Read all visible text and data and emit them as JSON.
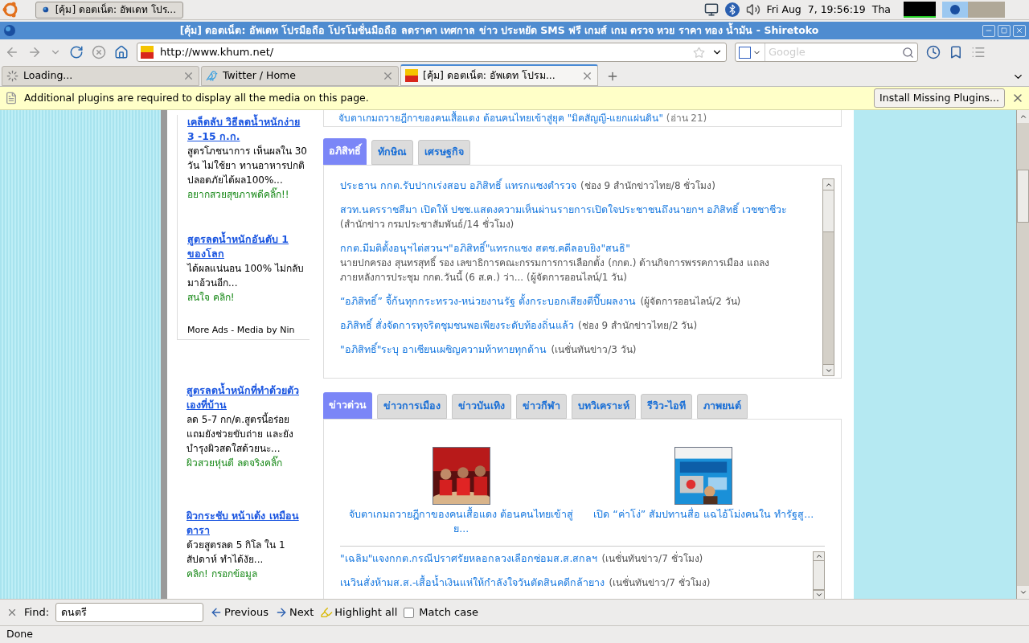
{
  "panel": {
    "taskbar_button": "[คุ้ม] ดอตเน็ต: อัพเดท โปร...",
    "clock": "Fri Aug  7, 19:56:19",
    "keyboard_layout": "Tha"
  },
  "window": {
    "title": "[คุ้ม] ดอตเน็ต: อัพเดท โปรมือถือ โปรโมชั่นมือถือ ลดราคา เทศกาล ข่าว ประหยัด SMS ฟรี เกมส์ เกม ตรวจ หวย ราคา ทอง น้ำมัน - Shiretoko"
  },
  "toolbar": {
    "url": "http://www.khum.net/",
    "search_placeholder": "Google"
  },
  "tabs": [
    {
      "kind": "loading",
      "label": "Loading...",
      "selected": false
    },
    {
      "kind": "bird",
      "label": "Twitter / Home",
      "selected": false
    },
    {
      "kind": "site",
      "label": "[คุ้ม] ดอตเน็ต: อัพเดท โปรม...",
      "selected": true
    }
  ],
  "notification": {
    "message": "Additional plugins are required to display all the media on this page.",
    "button": "Install Missing Plugins..."
  },
  "page": {
    "headline": {
      "title": "จับตาเกมถวายฎีกาของคนเสื้อแดง ต้อนคนไทยเข้าสู่ยุค \"มิคสัญญี-แยกแผ่นดิน\"",
      "meta": "(อ่าน 21)"
    },
    "ad_box": {
      "ads": [
        {
          "title": "เคล็ดลับ วิธีลดน้ำหนักง่าย 3 -15 ก.ก.",
          "body": "สูตรโภชนาการ เห็นผลใน 30 วัน ไม่ใช้ยา ทานอาหารปกติ ปลอดภัยได้ผล100%...",
          "action": "อยากสวยสุขภาพดีคลิ๊ก!!"
        },
        {
          "title": "สูตรลดน้ำหนักอันดับ 1 ของโลก",
          "body": "ได้ผลแน่นอน 100% ไม่กลับมาอ้วนอีก...",
          "action": "สนใจ คลิก!"
        }
      ],
      "footer": "More Ads - Media by Nin"
    },
    "more_ads": [
      {
        "title": "สูตรลดน้ำหนักที่ทำด้วยตัวเองที่บ้าน",
        "body": "ลด 5-7 กก/ด.สูตรนี้อร่อย แถมยังช่วยขับถ่าย และยังบำรุงผิวสดใสด้วยนะ...",
        "action": "ผิวสวยหุ่นดี ลดจริงคลิ๊ก"
      },
      {
        "title": "ผิวกระชับ หน้าเด้ง เหมือนดารา",
        "body": "ด้วยสูตรลด 5 กิโล ใน 1 สัปดาห์ ทำได้งัย...",
        "action": "คลิก! กรอกข้อมูล"
      }
    ],
    "tabs1": [
      {
        "label": "อภิสิทธิ์",
        "selected": true
      },
      {
        "label": "ทักษิณ",
        "selected": false
      },
      {
        "label": "เศรษฐกิจ",
        "selected": false
      }
    ],
    "news1": [
      {
        "title": "ประธาน กกต.รับปากเร่งสอบ อภิสิทธิ์ แทรกแซงตำรวจ",
        "meta": "(ช่อง 9 สำนักข่าวไทย/8 ชั่วโมง)"
      },
      {
        "title": "สวท.นครราชสีมา เปิดให้ ปชช.แสดงความเห็นผ่านรายการเปิดใจประชาชนถึงนายกฯ อภิสิทธิ์ เวชชาชีวะ",
        "meta": "(สำนักข่าว กรมประชาสัมพันธ์/14 ชั่วโมง)"
      },
      {
        "title": "กกต.มีมติตั้งอนุฯไต่สวนฯ\"อภิสิทธิ์\"แทรกแซง สตช.คดีลอบยิง\"สนธิ\"",
        "meta": "นายปกครอง สุนทรสุทธิ์ รอง เลขาธิการคณะกรรมการการเลือกตั้ง (กกต.) ด้านกิจการพรรคการเมือง แถลงภายหลังการประชุม กกต.วันนี้ (6 ส.ค.) ว่า... (ผู้จัดการออนไลน์/1 วัน)"
      },
      {
        "title": "“อภิสิทธิ์” จี้ก้นทุกกระทรวง-หน่วยงานรัฐ ตั้งกระบอกเสียงตีปี๊บผลงาน",
        "meta": "(ผู้จัดการออนไลน์/2 วัน)"
      },
      {
        "title": "อภิสิทธิ์ สั่งจัดการทุจริตชุมชนพอเพียงระดับท้องถิ่นแล้ว",
        "meta": "(ช่อง 9 สำนักข่าวไทย/2 วัน)"
      },
      {
        "title": "\"อภิสิทธิ์\"ระบุ อาเซียนเผชิญความท้าทายทุกด้าน",
        "meta": "(เนชั่นทันข่าว/3 วัน)"
      }
    ],
    "tabs2": [
      {
        "label": "ข่าวด่วน",
        "selected": true
      },
      {
        "label": "ข่าวการเมือง",
        "selected": false
      },
      {
        "label": "ข่าวบันเทิง",
        "selected": false
      },
      {
        "label": "ข่าวกีฬา",
        "selected": false
      },
      {
        "label": "บทวิเคราะห์",
        "selected": false
      },
      {
        "label": "รีวิว-ไอที",
        "selected": false
      },
      {
        "label": "ภาพยนต์",
        "selected": false
      }
    ],
    "featured": [
      {
        "kind": "picture",
        "caption": "จับตาเกมถวายฎีกาของคนเสื้อแดง ต้อนคนไทยเข้าสู่ย..."
      },
      {
        "kind": "picture",
        "caption": "เปิด “ค่าโง่” สัมปทานสื่อ แฉไอ้โม่งคนใน ทำรัฐสู..."
      }
    ],
    "news2": [
      {
        "title": "\"เฉลิม\"แจงกกต.กรณีปราศรัยหลอกลวงเลือกซ่อมส.ส.สกลฯ",
        "meta": "(เนชั่นทันข่าว/7 ชั่วโมง)"
      },
      {
        "title": "เนวินสั่งห้ามส.ส.-เสื้อน้ำเงินแห่ให้กำลังใจวันตัดสินคดีกล้ายาง",
        "meta": "(เนชั่นทันข่าว/7 ชั่วโมง)"
      }
    ]
  },
  "find_bar": {
    "label": "Find:",
    "value": "ดนตรี",
    "previous": "Previous",
    "next": "Next",
    "highlight": "Highlight all",
    "match_case": {
      "label": "Match case",
      "checked": false
    }
  },
  "status": "Done"
}
